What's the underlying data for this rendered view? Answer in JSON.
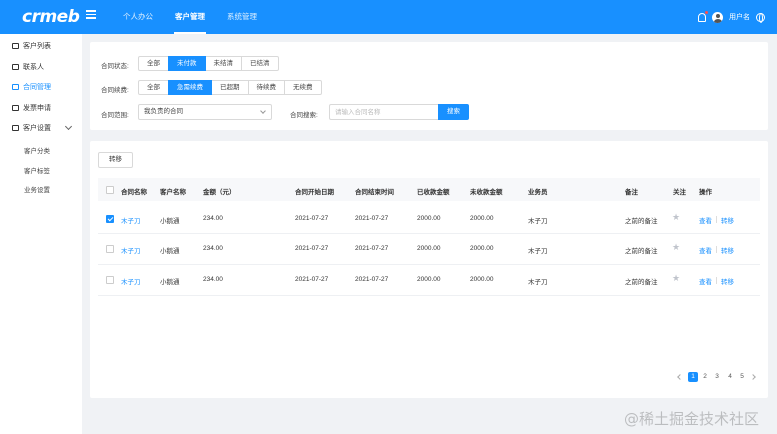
{
  "header": {
    "logo": "crmeb",
    "nav": [
      "个人办公",
      "客户管理",
      "系统管理"
    ],
    "active_nav": "客户管理",
    "username": "用户名",
    "brand_color": "#1890ff"
  },
  "sidebar": {
    "items": [
      "客户列表",
      "联系人",
      "合同管理",
      "发票申请",
      "客户设置"
    ],
    "active": "合同管理",
    "sub_items": [
      "客户分类",
      "客户标签",
      "业务设置"
    ]
  },
  "filters": {
    "status": {
      "label": "合同状态:",
      "options": [
        "全部",
        "未付款",
        "未结清",
        "已结清"
      ],
      "selected": "未付款"
    },
    "renewal": {
      "label": "合同续费:",
      "options": [
        "全部",
        "急需续费",
        "已超期",
        "待续费",
        "无续费"
      ],
      "selected": "急需续费"
    },
    "scope": {
      "label": "合同范围:",
      "value": "我负责的合同"
    },
    "search": {
      "label": "合同搜索:",
      "placeholder": "请输入合同名称",
      "button": "搜索"
    }
  },
  "toolbar": {
    "transfer_label": "转移"
  },
  "table": {
    "headers": [
      "合同名称",
      "客户名称",
      "金额（元）",
      "合同开始日期",
      "合同结束时间",
      "已收款金额",
      "未收款金额",
      "业务员",
      "备注",
      "关注",
      "操作"
    ],
    "rows": [
      {
        "checked": true,
        "name": "木子刀",
        "customer": "小鹅通",
        "amount": "234.00",
        "start": "2021-07-27",
        "end": "2021-07-27",
        "received": "2000.00",
        "unreceived": "2000.00",
        "salesman": "木子刀",
        "note": "之前的备注",
        "view": "查看",
        "transfer": "转移"
      },
      {
        "checked": false,
        "name": "木子刀",
        "customer": "小鹅通",
        "amount": "234.00",
        "start": "2021-07-27",
        "end": "2021-07-27",
        "received": "2000.00",
        "unreceived": "2000.00",
        "salesman": "木子刀",
        "note": "之前的备注",
        "view": "查看",
        "transfer": "转移"
      },
      {
        "checked": false,
        "name": "木子刀",
        "customer": "小鹅通",
        "amount": "234.00",
        "start": "2021-07-27",
        "end": "2021-07-27",
        "received": "2000.00",
        "unreceived": "2000.00",
        "salesman": "木子刀",
        "note": "之前的备注",
        "view": "查看",
        "transfer": "转移"
      }
    ]
  },
  "pagination": {
    "pages": [
      "1",
      "2",
      "3",
      "4",
      "5"
    ],
    "current": "1"
  },
  "watermark": "@稀土掘金技术社区"
}
